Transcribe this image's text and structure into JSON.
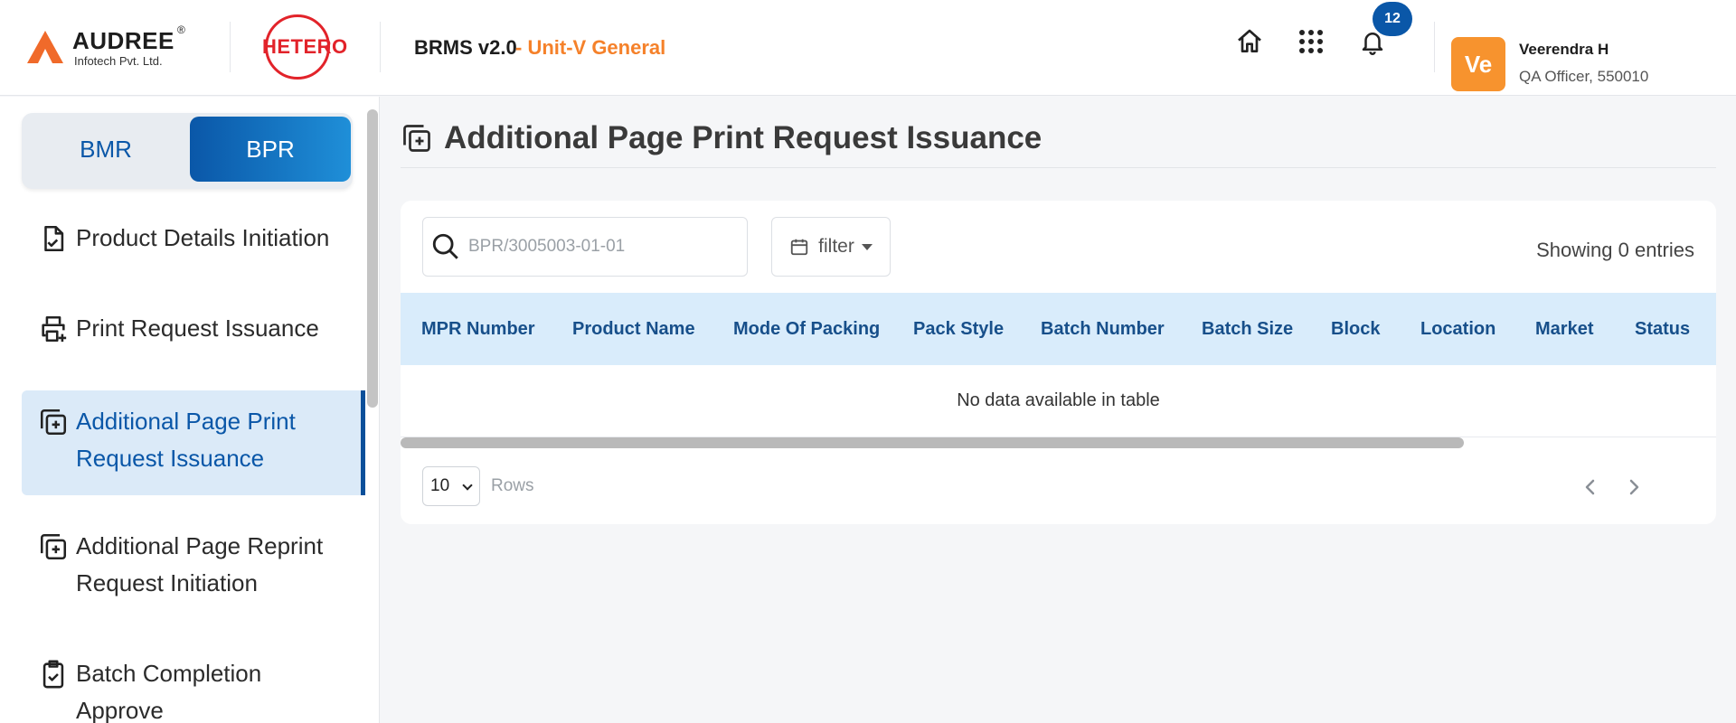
{
  "brand": {
    "name": "AUDREE",
    "reg": "®",
    "sub": "Infotech Pvt. Ltd.",
    "partner": "HETERO"
  },
  "app": {
    "title": "BRMS v2.0",
    "unit": "- Unit-V General"
  },
  "header": {
    "notifications": "12",
    "icons": [
      "home-icon",
      "apps-grid-icon",
      "bell-icon"
    ]
  },
  "user": {
    "initials": "Ve",
    "name": "Veerendra H",
    "role": "QA Officer, 550010"
  },
  "sidebar": {
    "toggle": {
      "left": "BMR",
      "right": "BPR",
      "selected": "BPR"
    },
    "items": [
      {
        "label": "Product Details Initiation",
        "icon": "file-check-icon"
      },
      {
        "label": "Print Request Issuance",
        "icon": "printer-plus-icon"
      },
      {
        "label": "Additional Page Print Request Issuance",
        "icon": "copy-plus-icon",
        "active": true
      },
      {
        "label": "Additional Page Reprint Request Initiation",
        "icon": "copy-plus-icon"
      },
      {
        "label": "Batch Completion Approve",
        "icon": "clipboard-check-icon"
      }
    ]
  },
  "main": {
    "title": "Additional Page Print Request Issuance",
    "search": {
      "placeholder": "BPR/3005003-01-01",
      "value": ""
    },
    "filter_label": "filter",
    "showing": "Showing 0 entries",
    "table": {
      "columns": [
        "MPR Number",
        "Product Name",
        "Mode Of Packing",
        "Pack Style",
        "Batch Number",
        "Batch Size",
        "Block",
        "Location",
        "Market",
        "Status"
      ],
      "empty_message": "No data available in table"
    },
    "pagination": {
      "rows_value": "10",
      "rows_label": "Rows"
    }
  },
  "colors": {
    "primary": "#0a57a8",
    "accent": "#f5812a",
    "header_row": "#d9ecfb",
    "active_nav": "#dbeaf8"
  }
}
